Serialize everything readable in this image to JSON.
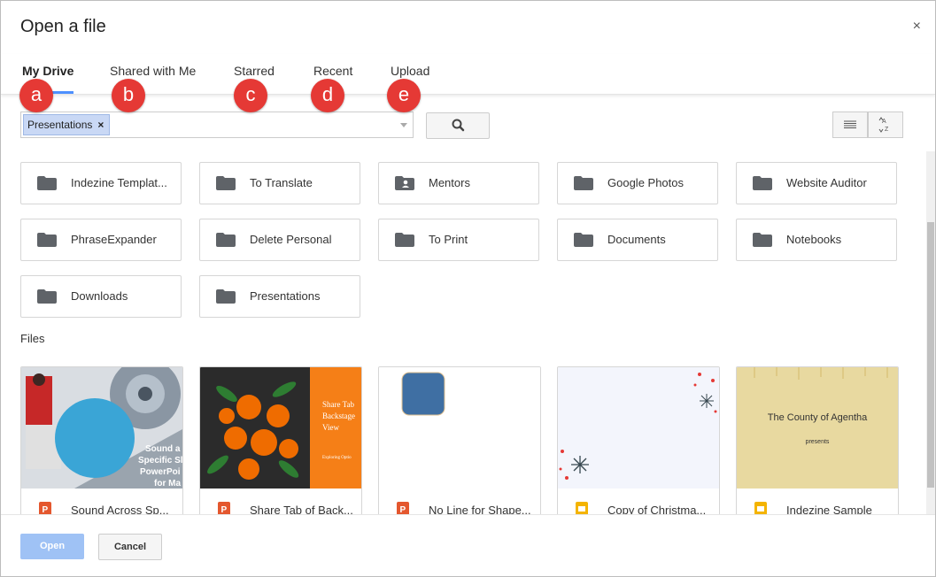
{
  "dialog": {
    "title": "Open a file",
    "close_glyph": "×"
  },
  "tabs": [
    "My Drive",
    "Shared with Me",
    "Starred",
    "Recent",
    "Upload"
  ],
  "badges": [
    "a",
    "b",
    "c",
    "d",
    "e"
  ],
  "search": {
    "chip_label": "Presentations",
    "chip_remove": "×"
  },
  "folders": [
    "Indezine Templat...",
    "To Translate",
    "Mentors",
    "Google Photos",
    "Website Auditor",
    "PhraseExpander",
    "Delete Personal",
    "To Print",
    "Documents",
    "Notebooks",
    "Downloads",
    "Presentations"
  ],
  "files_label": "Files",
  "files": [
    {
      "name": "Sound Across Sp...",
      "type": "powerpoint-icon",
      "thumb_text": [
        "Sound a",
        "Specific Sli",
        "PowerPoi",
        "for Ma"
      ]
    },
    {
      "name": "Share Tab of Back...",
      "type": "powerpoint-icon",
      "thumb_text": [
        "Share Tab",
        "Backstage",
        "View",
        "Exploring Optio"
      ]
    },
    {
      "name": "No Line for Shape...",
      "type": "powerpoint-icon",
      "thumb_text": []
    },
    {
      "name": "Copy of Christma...",
      "type": "slides-icon",
      "thumb_text": []
    },
    {
      "name": "Indezine Sample",
      "type": "slides-icon",
      "thumb_text": [
        "The County of Agentha",
        "presents"
      ]
    }
  ],
  "footer": {
    "open_label": "Open",
    "cancel_label": "Cancel"
  },
  "colors": {
    "accent": "#4d90fe",
    "badge": "#e53935",
    "powerpoint": "#e4572e",
    "slides": "#f4b400"
  }
}
